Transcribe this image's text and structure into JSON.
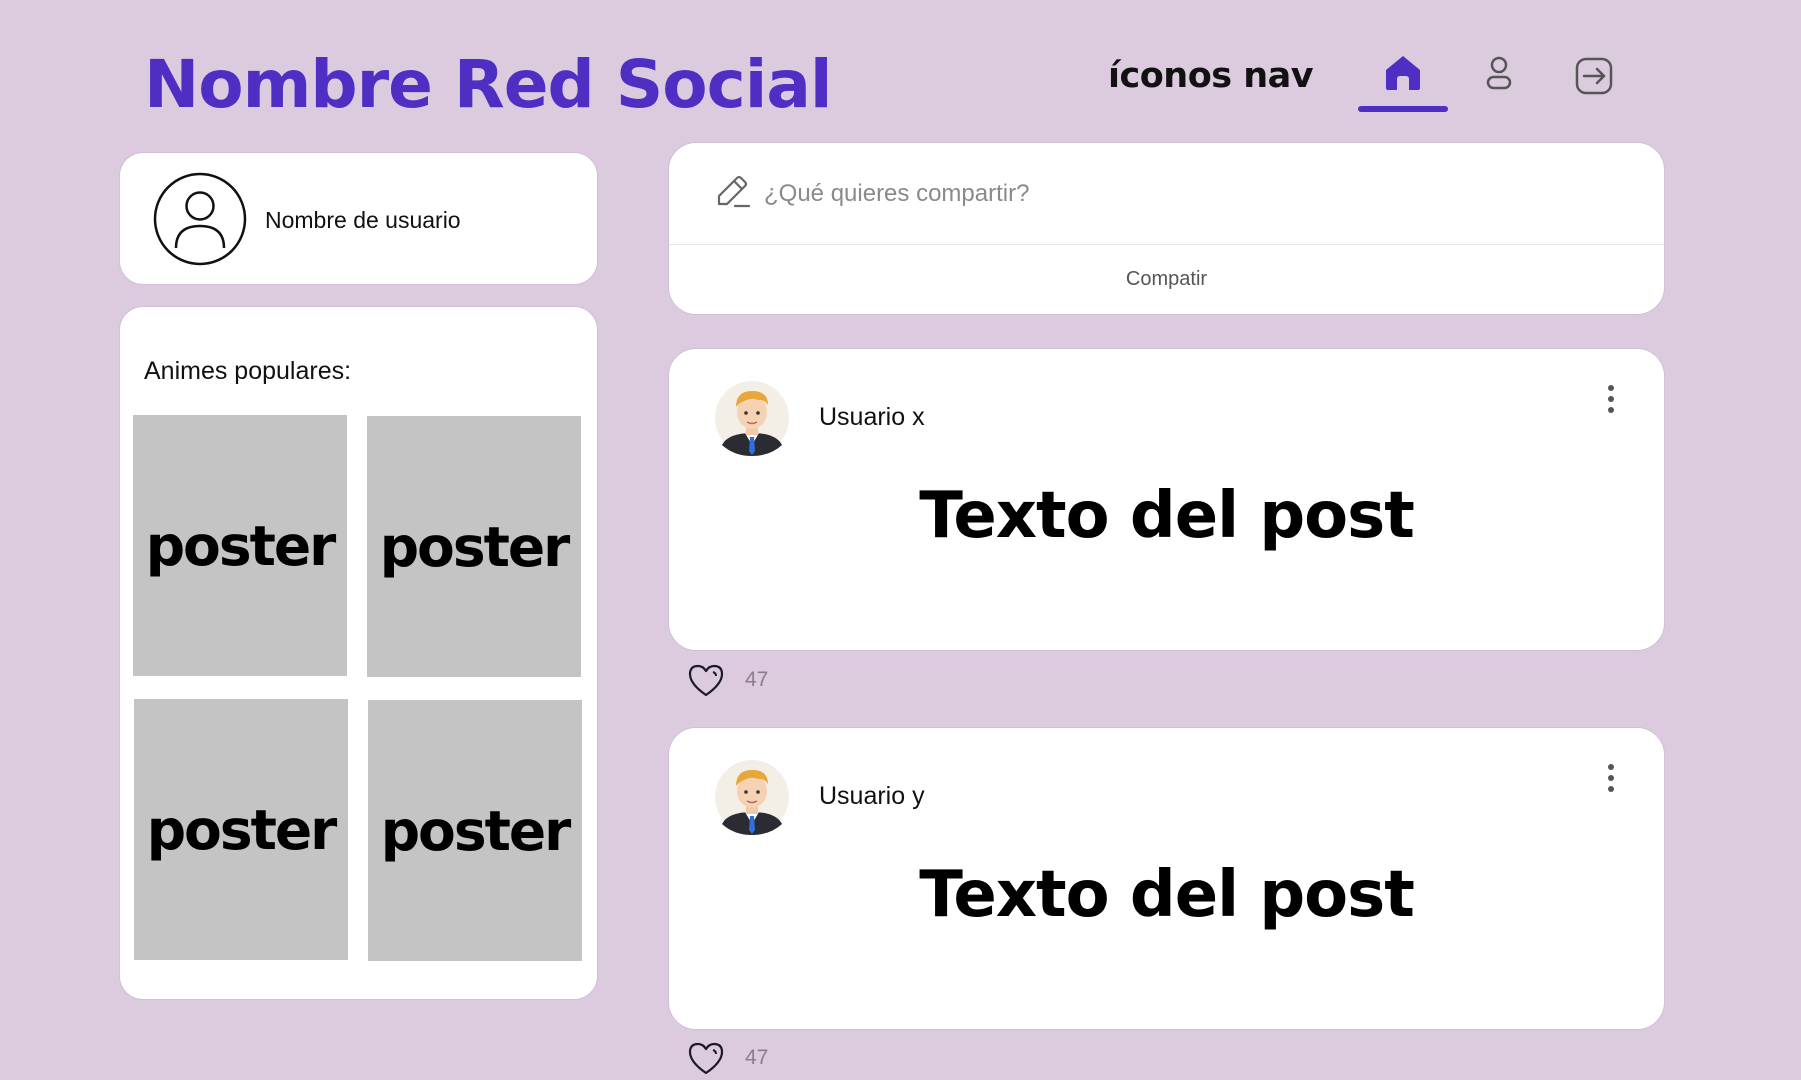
{
  "header": {
    "brand": "Nombre Red Social",
    "nav_label": "íconos nav",
    "nav_icons": [
      "home-icon",
      "user-icon",
      "logout-icon"
    ],
    "active_nav": "home"
  },
  "sidebar": {
    "username": "Nombre de usuario",
    "popular_title": "Animes populares:",
    "posters": [
      "poster",
      "poster",
      "poster",
      "poster"
    ]
  },
  "composer": {
    "placeholder": "¿Qué quieres compartir?",
    "share_label": "Compatir"
  },
  "posts": [
    {
      "user": "Usuario x",
      "text": "Texto del post",
      "likes": "47"
    },
    {
      "user": "Usuario y",
      "text": "Texto del post",
      "likes": "47"
    }
  ],
  "colors": {
    "background": "#dccadf",
    "accent": "#4f2ec4",
    "poster_placeholder": "#c4c4c4"
  }
}
